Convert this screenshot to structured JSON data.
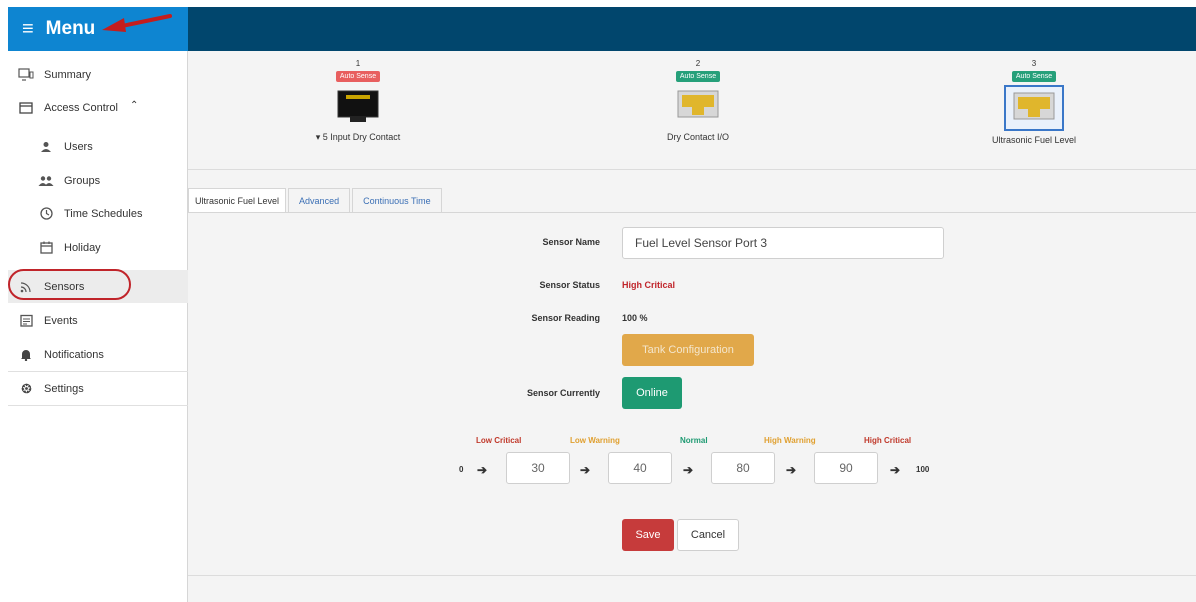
{
  "menu": {
    "title": "Menu"
  },
  "sidebar": {
    "summary": "Summary",
    "access_control": "Access Control",
    "users": "Users",
    "groups": "Groups",
    "time_schedules": "Time Schedules",
    "holiday": "Holiday",
    "sensors": "Sensors",
    "events": "Events",
    "notifications": "Notifications",
    "settings": "Settings"
  },
  "ports": [
    {
      "num": "1",
      "badge": "Auto Sense",
      "label": "▾ 5 Input Dry Contact",
      "badge_color": "#e85f5f"
    },
    {
      "num": "2",
      "badge": "Auto Sense",
      "label": "Dry Contact I/O",
      "badge_color": "#26a07a"
    },
    {
      "num": "3",
      "badge": "Auto Sense",
      "label": "Ultrasonic Fuel Level",
      "badge_color": "#26a07a"
    }
  ],
  "tabs": {
    "ultrasonic": "Ultrasonic Fuel Level",
    "advanced": "Advanced",
    "continuous": "Continuous Time"
  },
  "form": {
    "sensor_name_label": "Sensor Name",
    "sensor_name_value": "Fuel Level Sensor Port 3",
    "sensor_status_label": "Sensor Status",
    "sensor_status_value": "High Critical",
    "sensor_reading_label": "Sensor Reading",
    "sensor_reading_value": "100 %",
    "tank_button": "Tank Configuration",
    "sensor_currently_label": "Sensor Currently",
    "online_button": "Online",
    "save_button": "Save",
    "cancel_button": "Cancel"
  },
  "thresholds": {
    "low_critical": "Low Critical",
    "low_warning": "Low Warning",
    "normal": "Normal",
    "high_warning": "High Warning",
    "high_critical": "High Critical",
    "min": "0",
    "max": "100",
    "v1": "30",
    "v2": "40",
    "v3": "80",
    "v4": "90"
  },
  "colors": {
    "critical": "#c0392b",
    "warning": "#e0a030",
    "normal": "#1e9a72",
    "status_text": "#c0242a"
  }
}
